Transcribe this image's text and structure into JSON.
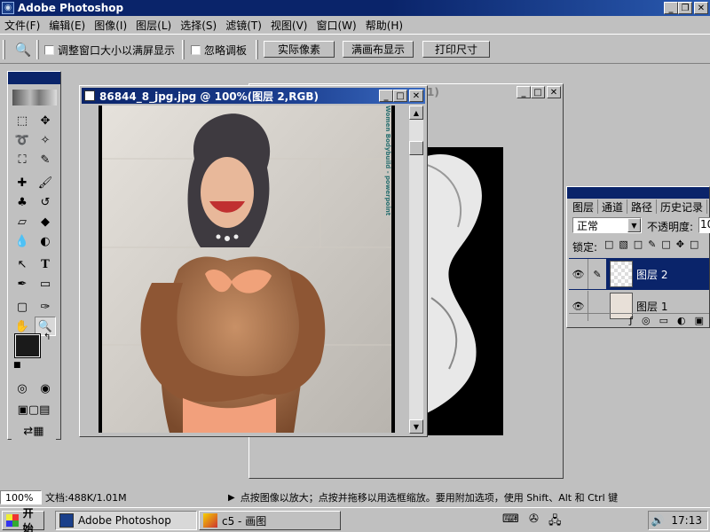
{
  "app": {
    "title": "Adobe Photoshop"
  },
  "menubar": [
    "文件(F)",
    "编辑(E)",
    "图像(I)",
    "图层(L)",
    "选择(S)",
    "滤镜(T)",
    "视图(V)",
    "窗口(W)",
    "帮助(H)"
  ],
  "options": {
    "checkbox_resize": "调整窗口大小以满屏显示",
    "checkbox_ignore": "忽略调板",
    "btn_actual": "实际像素",
    "btn_fit": "满画布显示",
    "btn_print": "打印尺寸"
  },
  "document": {
    "title": "86844_8_jpg.jpg @ 100%(图层 2,RGB)",
    "back_title_fragment": "1)",
    "side_watermark": "Women Bodybuild - powerpoint"
  },
  "layers_panel": {
    "tabs": [
      "图层",
      "通道",
      "路径",
      "历史记录"
    ],
    "blend_mode": "正常",
    "opacity_label": "不透明度:",
    "opacity_value": "10",
    "lock_label": "锁定:",
    "layers": [
      {
        "name": "图层 2",
        "selected": true
      },
      {
        "name": "图层 1",
        "selected": false
      }
    ]
  },
  "status": {
    "zoom": "100%",
    "doc_info": "文档:488K/1.01M",
    "hint": "点按图像以放大；点按并拖移以用选框缩放。要用附加选项，使用 Shift、Alt 和 Ctrl 键"
  },
  "taskbar": {
    "start": "开始",
    "tasks": [
      "Adobe Photoshop",
      "c5 - 画图"
    ],
    "clock": "17:13"
  },
  "colors": {
    "title_active": "#0a246a",
    "face": "#c0c0c0"
  }
}
